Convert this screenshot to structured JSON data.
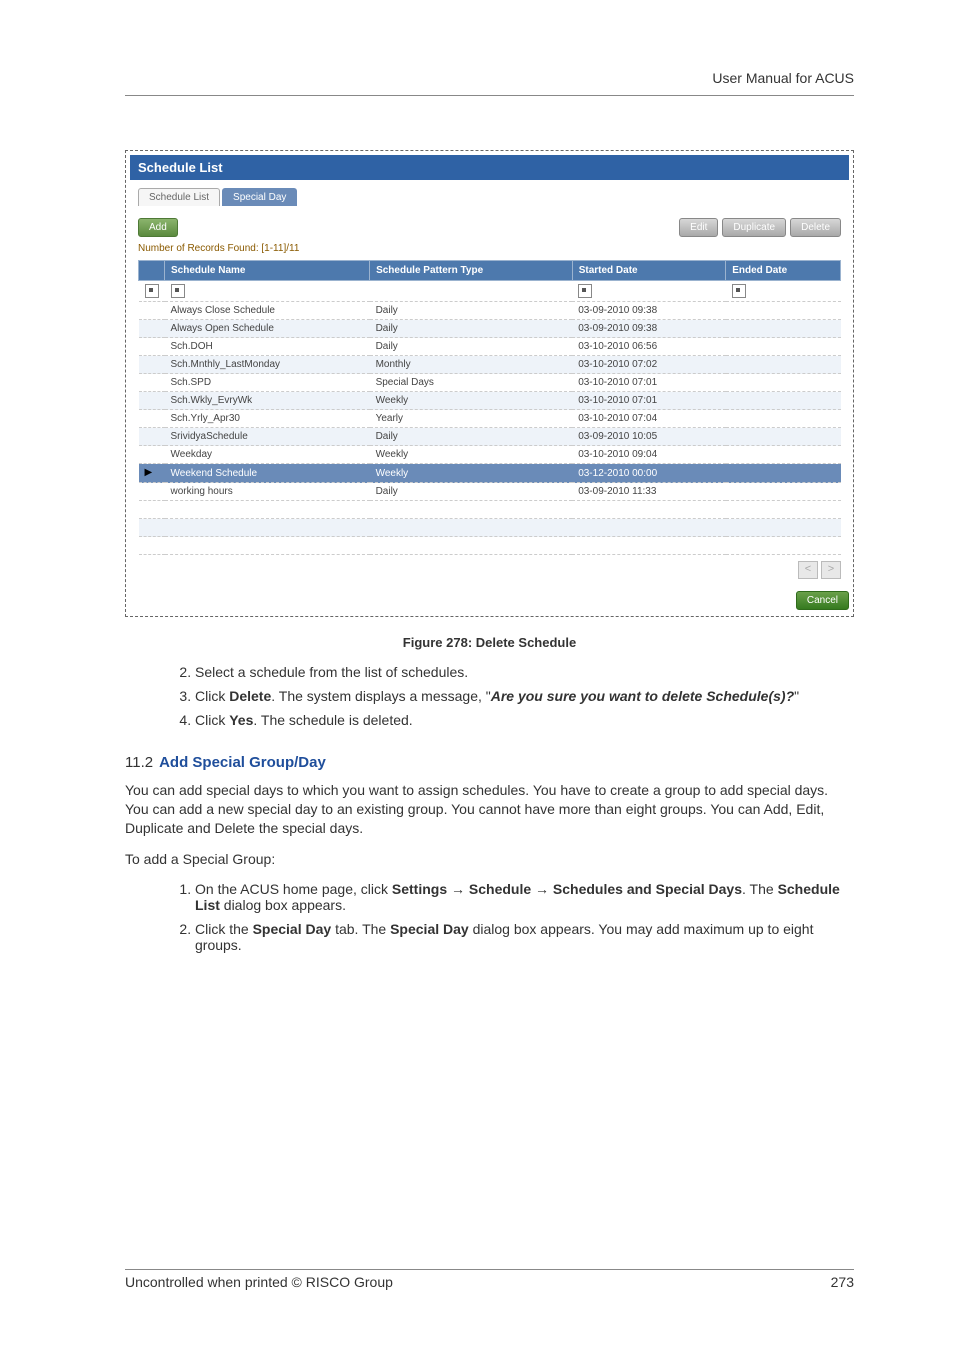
{
  "header": {
    "title": "User Manual for ACUS"
  },
  "screenshot": {
    "title": "Schedule List",
    "tabs": {
      "t0": "Schedule List",
      "t1": "Special Day"
    },
    "buttons": {
      "add": "Add",
      "edit": "Edit",
      "duplicate": "Duplicate",
      "delete": "Delete"
    },
    "records_label": "Number of Records Found: [1-11]/11",
    "columns": {
      "c0": "Schedule Name",
      "c1": "Schedule Pattern Type",
      "c2": "Started Date",
      "c3": "Ended Date"
    },
    "rows": [
      {
        "name": "Always Close Schedule",
        "type": "Daily",
        "start": "03-09-2010 09:38",
        "end": ""
      },
      {
        "name": "Always Open Schedule",
        "type": "Daily",
        "start": "03-09-2010 09:38",
        "end": ""
      },
      {
        "name": "Sch.DOH",
        "type": "Daily",
        "start": "03-10-2010 06:56",
        "end": ""
      },
      {
        "name": "Sch.Mnthly_LastMonday",
        "type": "Monthly",
        "start": "03-10-2010 07:02",
        "end": ""
      },
      {
        "name": "Sch.SPD",
        "type": "Special Days",
        "start": "03-10-2010 07:01",
        "end": ""
      },
      {
        "name": "Sch.Wkly_EvryWk",
        "type": "Weekly",
        "start": "03-10-2010 07:01",
        "end": ""
      },
      {
        "name": "Sch.Yrly_Apr30",
        "type": "Yearly",
        "start": "03-10-2010 07:04",
        "end": ""
      },
      {
        "name": "SrividyaSchedule",
        "type": "Daily",
        "start": "03-09-2010 10:05",
        "end": ""
      },
      {
        "name": "Weekday",
        "type": "Weekly",
        "start": "03-10-2010 09:04",
        "end": ""
      },
      {
        "name": "Weekend Schedule",
        "type": "Weekly",
        "start": "03-12-2010 00:00",
        "end": "",
        "selected": true
      },
      {
        "name": "working hours",
        "type": "Daily",
        "start": "03-09-2010 11:33",
        "end": ""
      }
    ],
    "pager": {
      "prev": "<",
      "next": ">"
    },
    "cancel": "Cancel"
  },
  "caption": "Figure 278: Delete Schedule",
  "steps_a": {
    "s2_a": "Select a schedule from the list of schedules.",
    "s3_a": "Click ",
    "s3_b": "Delete",
    "s3_c": ". The system displays a message, \"",
    "s3_d": "Are you sure you want to delete Schedule(s)?",
    "s3_e": "\"",
    "s4_a": "Click ",
    "s4_b": "Yes",
    "s4_c": ". The schedule is deleted."
  },
  "section": {
    "num": "11.2",
    "title": "Add Special Group/Day"
  },
  "para1": "You can add special days to which you want to assign schedules. You have to create a group to add special days. You can add a new special day to an existing group. You cannot have more than eight groups. You can Add, Edit, Duplicate and Delete the special days.",
  "para2": "To add a Special Group:",
  "steps_b": {
    "s1_a": "On the ACUS home page, click ",
    "s1_b": "Settings",
    "s1_c": " ",
    "s1_ar": "→",
    "s1_d": " ",
    "s1_e": "Schedule",
    "s1_f": " ",
    "s1_ar2": "→",
    "s1_g": " ",
    "s1_h": "Schedules and Special Days",
    "s1_i": ". The ",
    "s1_j": "Schedule List",
    "s1_k": " dialog box appears.",
    "s2_a": "Click the ",
    "s2_b": "Special Day",
    "s2_c": " tab. The ",
    "s2_d": "Special Day",
    "s2_e": " dialog box appears. You may add maximum up to eight groups."
  },
  "footer": {
    "left": "Uncontrolled when printed © RISCO Group",
    "right": "273"
  },
  "chart_data": {
    "type": "table",
    "title": "Schedule List",
    "columns": [
      "Schedule Name",
      "Schedule Pattern Type",
      "Started Date",
      "Ended Date"
    ],
    "records_found": "[1-11]/11",
    "rows": [
      [
        "Always Close Schedule",
        "Daily",
        "03-09-2010 09:38",
        ""
      ],
      [
        "Always Open Schedule",
        "Daily",
        "03-09-2010 09:38",
        ""
      ],
      [
        "Sch.DOH",
        "Daily",
        "03-10-2010 06:56",
        ""
      ],
      [
        "Sch.Mnthly_LastMonday",
        "Monthly",
        "03-10-2010 07:02",
        ""
      ],
      [
        "Sch.SPD",
        "Special Days",
        "03-10-2010 07:01",
        ""
      ],
      [
        "Sch.Wkly_EvryWk",
        "Weekly",
        "03-10-2010 07:01",
        ""
      ],
      [
        "Sch.Yrly_Apr30",
        "Yearly",
        "03-10-2010 07:04",
        ""
      ],
      [
        "SrividyaSchedule",
        "Daily",
        "03-09-2010 10:05",
        ""
      ],
      [
        "Weekday",
        "Weekly",
        "03-10-2010 09:04",
        ""
      ],
      [
        "Weekend Schedule",
        "Weekly",
        "03-12-2010 00:00",
        ""
      ],
      [
        "working hours",
        "Daily",
        "03-09-2010 11:33",
        ""
      ]
    ],
    "selected_row_index": 9
  }
}
